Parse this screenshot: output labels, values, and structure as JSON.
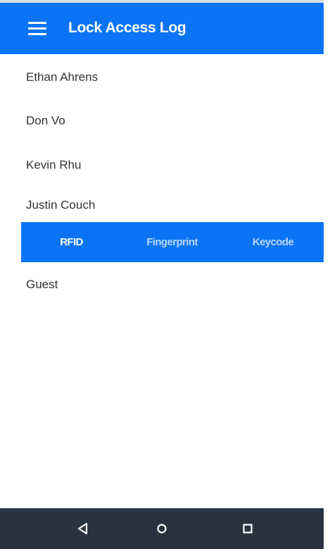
{
  "app_bar": {
    "title": "Lock Access Log",
    "menu_icon": "hamburger-menu-icon"
  },
  "users": [
    {
      "name": "Ethan Ahrens"
    },
    {
      "name": "Don Vo"
    },
    {
      "name": "Kevin Rhu"
    },
    {
      "name": "Justin Couch"
    },
    {
      "name": "Guest"
    }
  ],
  "tabs": [
    {
      "label": "RFID",
      "active": true
    },
    {
      "label": "Fingerprint",
      "active": false
    },
    {
      "label": "Keycode",
      "active": false
    }
  ],
  "nav_bar": {
    "back_icon": "back-triangle-icon",
    "home_icon": "home-circle-icon",
    "recents_icon": "recents-square-icon"
  },
  "colors": {
    "accent": "#0a74f5",
    "nav_bar": "#283341",
    "text": "#333333"
  }
}
